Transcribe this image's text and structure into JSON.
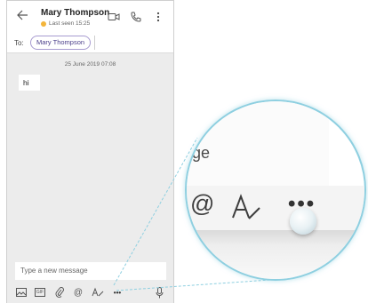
{
  "header": {
    "contact_name": "Mary Thompson",
    "presence": "Last seen 15:25",
    "presence_color": "#f3b53b"
  },
  "to_row": {
    "label": "To:",
    "recipient": "Mary Thompson"
  },
  "conversation": {
    "date": "25 June 2019 07:08",
    "messages": [
      {
        "text": "hi"
      }
    ]
  },
  "composer": {
    "placeholder": "Type a new message"
  },
  "toolbar": {
    "icons": [
      "image-icon",
      "gif-icon",
      "attach-icon",
      "mention-icon",
      "format-icon",
      "more-icon",
      "mic-icon"
    ],
    "gif_label": "GIF",
    "more_label": "•••"
  },
  "zoom": {
    "text_fragment": "ge",
    "mention_glyph": "@",
    "more_label": "•••",
    "highlight_color": "#8ecfe0"
  },
  "colors": {
    "accent": "#4b3f8a",
    "chip_border": "#a79bd0"
  }
}
